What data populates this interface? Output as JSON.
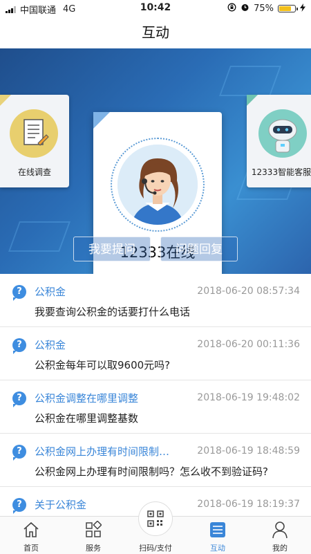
{
  "status_bar": {
    "carrier": "中国联通",
    "network": "4G",
    "time": "10:42",
    "battery": "75%",
    "battery_level": 0.75
  },
  "header": {
    "title": "互动"
  },
  "banner": {
    "left_card": {
      "label": "在线调查",
      "icon": "survey-icon"
    },
    "center_card": {
      "label": "12333在线",
      "icon": "agent-avatar-icon"
    },
    "right_card": {
      "label": "12333智能客服",
      "icon": "robot-icon"
    },
    "ask_button": "我要提问",
    "reply_button": "问题回复"
  },
  "questions": [
    {
      "category": "公积金",
      "time": "2018-06-20 08:57:34",
      "question": "我要查询公积金的话要打什么电话"
    },
    {
      "category": "公积金",
      "time": "2018-06-20 00:11:36",
      "question": "公积金每年可以取9600元吗?"
    },
    {
      "category": "公积金调整在哪里调整",
      "time": "2018-06-19 19:48:02",
      "question": "公积金在哪里调整基数"
    },
    {
      "category": "公积金网上办理有时间限制吗...",
      "time": "2018-06-19 18:48:59",
      "question": "公积金网上办理有时间限制吗？怎么收不到验证码?"
    },
    {
      "category": "关于公积金",
      "time": "2018-06-19 18:19:37",
      "question": ""
    }
  ],
  "tabs": [
    {
      "label": "首页",
      "icon": "home-icon"
    },
    {
      "label": "服务",
      "icon": "grid-icon"
    },
    {
      "label": "扫码/支付",
      "icon": "qr-code-icon"
    },
    {
      "label": "互动",
      "icon": "list-icon",
      "active": true
    },
    {
      "label": "我的",
      "icon": "person-icon"
    }
  ],
  "colors": {
    "accent": "#3a86d8",
    "banner": "#2a6cb5"
  }
}
